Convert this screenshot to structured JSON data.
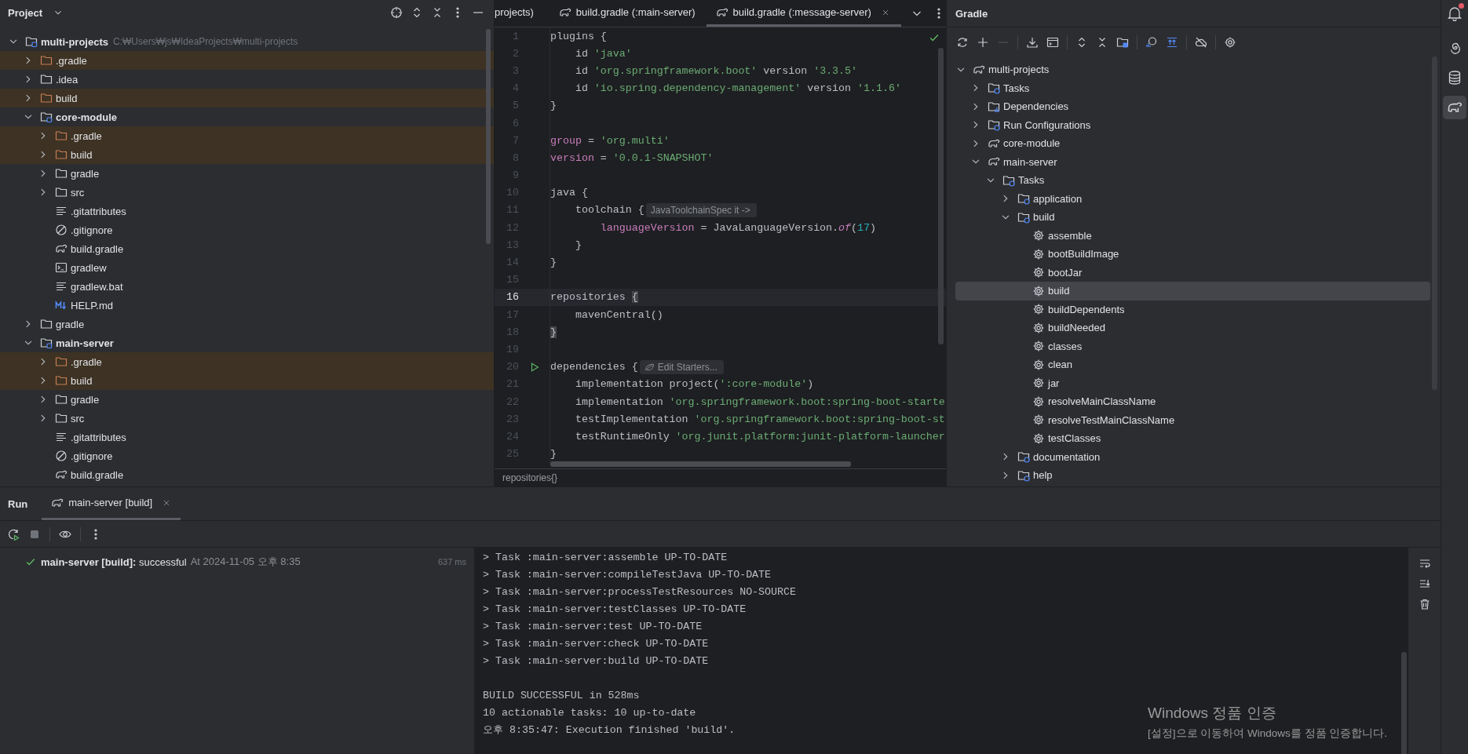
{
  "project": {
    "title": "Project",
    "tree": [
      {
        "name": "multi-projects",
        "kind": "module",
        "path": "C:₩Users₩js₩IdeaProjects₩multi-projects",
        "expanded": true,
        "children": [
          {
            "name": ".gradle",
            "kind": "folder",
            "excluded": true,
            "expanded": false
          },
          {
            "name": ".idea",
            "kind": "folder",
            "excluded": false,
            "expanded": false
          },
          {
            "name": "build",
            "kind": "folder",
            "excluded": true,
            "expanded": false
          },
          {
            "name": "core-module",
            "kind": "module",
            "expanded": true,
            "children": [
              {
                "name": ".gradle",
                "kind": "folder",
                "excluded": true,
                "expanded": false
              },
              {
                "name": "build",
                "kind": "folder",
                "excluded": true,
                "expanded": false
              },
              {
                "name": "gradle",
                "kind": "folder",
                "excluded": false,
                "expanded": false
              },
              {
                "name": "src",
                "kind": "folder",
                "excluded": false,
                "expanded": false
              },
              {
                "name": ".gitattributes",
                "kind": "text"
              },
              {
                "name": ".gitignore",
                "kind": "ignore"
              },
              {
                "name": "build.gradle",
                "kind": "gradle"
              },
              {
                "name": "gradlew",
                "kind": "terminal"
              },
              {
                "name": "gradlew.bat",
                "kind": "text"
              },
              {
                "name": "HELP.md",
                "kind": "markdown"
              }
            ]
          },
          {
            "name": "gradle",
            "kind": "folder",
            "excluded": false,
            "expanded": false
          },
          {
            "name": "main-server",
            "kind": "module",
            "expanded": true,
            "children": [
              {
                "name": ".gradle",
                "kind": "folder",
                "excluded": true,
                "expanded": false
              },
              {
                "name": "build",
                "kind": "folder",
                "excluded": true,
                "expanded": false
              },
              {
                "name": "gradle",
                "kind": "folder",
                "excluded": false,
                "expanded": false
              },
              {
                "name": "src",
                "kind": "folder",
                "excluded": false,
                "expanded": false
              },
              {
                "name": ".gitattributes",
                "kind": "text"
              },
              {
                "name": ".gitignore",
                "kind": "ignore"
              },
              {
                "name": "build.gradle",
                "kind": "gradle"
              }
            ]
          }
        ]
      }
    ]
  },
  "editor": {
    "tabs": [
      {
        "label": "projects)",
        "kind": "cut",
        "selected": false
      },
      {
        "label": "build.gradle (:main-server)",
        "kind": "file",
        "selected": false
      },
      {
        "label": "build.gradle (:message-server)",
        "kind": "file",
        "selected": true
      }
    ],
    "lines": [
      {
        "n": "1",
        "current": false,
        "run": false,
        "code": [
          {
            "text": "plugins {",
            "kind": "plain"
          }
        ]
      },
      {
        "n": "2",
        "current": false,
        "run": false,
        "code": [
          {
            "text": "    id ",
            "kind": "plain"
          },
          {
            "text": "'java'",
            "kind": "string"
          }
        ]
      },
      {
        "n": "3",
        "current": false,
        "run": false,
        "code": [
          {
            "text": "    id ",
            "kind": "plain"
          },
          {
            "text": "'org.springframework.boot'",
            "kind": "string"
          },
          {
            "text": " version ",
            "kind": "plain"
          },
          {
            "text": "'3.3.5'",
            "kind": "string"
          }
        ]
      },
      {
        "n": "4",
        "current": false,
        "run": false,
        "code": [
          {
            "text": "    id ",
            "kind": "plain"
          },
          {
            "text": "'io.spring.dependency-management'",
            "kind": "string"
          },
          {
            "text": " version ",
            "kind": "plain"
          },
          {
            "text": "'1.1.6'",
            "kind": "string"
          }
        ]
      },
      {
        "n": "5",
        "current": false,
        "run": false,
        "code": [
          {
            "text": "}",
            "kind": "plain"
          }
        ]
      },
      {
        "n": "6",
        "current": false,
        "run": false
      },
      {
        "n": "7",
        "current": false,
        "run": false,
        "code": [
          {
            "text": "group",
            "kind": "property"
          },
          {
            "text": " = ",
            "kind": "plain"
          },
          {
            "text": "'org.multi'",
            "kind": "string"
          }
        ]
      },
      {
        "n": "8",
        "current": false,
        "run": false,
        "code": [
          {
            "text": "version",
            "kind": "property"
          },
          {
            "text": " = ",
            "kind": "plain"
          },
          {
            "text": "'0.0.1-SNAPSHOT'",
            "kind": "string"
          }
        ]
      },
      {
        "n": "9",
        "current": false,
        "run": false
      },
      {
        "n": "10",
        "current": false,
        "run": false,
        "code": [
          {
            "text": "java {",
            "kind": "plain"
          }
        ]
      },
      {
        "n": "11",
        "current": false,
        "run": false,
        "code": [
          {
            "text": "    toolchain {",
            "kind": "plain"
          }
        ],
        "hint": {
          "text": "JavaToolchainSpec it ->",
          "kind": "type"
        }
      },
      {
        "n": "12",
        "current": false,
        "run": false,
        "code": [
          {
            "text": "        languageVersion",
            "kind": "property"
          },
          {
            "text": " = JavaLanguageVersion.",
            "kind": "plain"
          },
          {
            "text": "of",
            "kind": "italic"
          },
          {
            "text": "(",
            "kind": "plain"
          },
          {
            "text": "17",
            "kind": "number"
          },
          {
            "text": ")",
            "kind": "plain"
          }
        ]
      },
      {
        "n": "13",
        "current": false,
        "run": false,
        "code": [
          {
            "text": "    }",
            "kind": "plain"
          }
        ]
      },
      {
        "n": "14",
        "current": false,
        "run": false,
        "code": [
          {
            "text": "}",
            "kind": "plain"
          }
        ]
      },
      {
        "n": "15",
        "current": false,
        "run": false
      },
      {
        "n": "16",
        "current": true,
        "run": false,
        "code": [
          {
            "text": "repositories ",
            "kind": "plain"
          },
          {
            "text": "{",
            "kind": "brace"
          }
        ]
      },
      {
        "n": "17",
        "current": false,
        "run": false,
        "code": [
          {
            "text": "    mavenCentral()",
            "kind": "plain"
          }
        ]
      },
      {
        "n": "18",
        "current": false,
        "run": false,
        "code": [
          {
            "text": "}",
            "kind": "brace"
          }
        ]
      },
      {
        "n": "19",
        "current": false,
        "run": false
      },
      {
        "n": "20",
        "current": false,
        "run": true,
        "code": [
          {
            "text": "dependencies {",
            "kind": "plain"
          }
        ],
        "hint": {
          "text": "Edit Starters...",
          "kind": "spring"
        }
      },
      {
        "n": "21",
        "current": false,
        "run": false,
        "code": [
          {
            "text": "    implementation project(",
            "kind": "plain"
          },
          {
            "text": "':core-module'",
            "kind": "string"
          },
          {
            "text": ")",
            "kind": "plain"
          }
        ]
      },
      {
        "n": "22",
        "current": false,
        "run": false,
        "code": [
          {
            "text": "    implementation ",
            "kind": "plain"
          },
          {
            "text": "'org.springframework.boot:spring-boot-starte",
            "kind": "string"
          }
        ]
      },
      {
        "n": "23",
        "current": false,
        "run": false,
        "code": [
          {
            "text": "    testImplementation ",
            "kind": "plain"
          },
          {
            "text": "'org.springframework.boot:spring-boot-st",
            "kind": "string"
          }
        ]
      },
      {
        "n": "24",
        "current": false,
        "run": false,
        "code": [
          {
            "text": "    testRuntimeOnly ",
            "kind": "plain"
          },
          {
            "text": "'org.junit.platform:junit-platform-launcher",
            "kind": "string"
          }
        ]
      },
      {
        "n": "25",
        "current": false,
        "run": false,
        "code": [
          {
            "text": "}",
            "kind": "plain"
          }
        ]
      }
    ],
    "breadcrumb": "repositories{}"
  },
  "gradle": {
    "title": "Gradle",
    "tree": [
      {
        "name": "multi-projects",
        "kind": "gradle",
        "expanded": true,
        "selected": false,
        "children": [
          {
            "name": "Tasks",
            "kind": "tasks",
            "expanded": false,
            "selected": false
          },
          {
            "name": "Dependencies",
            "kind": "deps",
            "expanded": false,
            "selected": false
          },
          {
            "name": "Run Configurations",
            "kind": "tasks",
            "expanded": false,
            "selected": false
          },
          {
            "name": "core-module",
            "kind": "gradle",
            "expanded": false,
            "selected": false
          },
          {
            "name": "main-server",
            "kind": "gradle",
            "expanded": true,
            "selected": false,
            "children": [
              {
                "name": "Tasks",
                "kind": "tasks",
                "expanded": true,
                "selected": false,
                "children": [
                  {
                    "name": "application",
                    "kind": "tasks",
                    "expanded": false,
                    "selected": false
                  },
                  {
                    "name": "build",
                    "kind": "tasks",
                    "expanded": true,
                    "selected": false,
                    "children": [
                      {
                        "name": "assemble",
                        "kind": "task",
                        "selected": false
                      },
                      {
                        "name": "bootBuildImage",
                        "kind": "task",
                        "selected": false
                      },
                      {
                        "name": "bootJar",
                        "kind": "task",
                        "selected": false
                      },
                      {
                        "name": "build",
                        "kind": "task",
                        "selected": true
                      },
                      {
                        "name": "buildDependents",
                        "kind": "task",
                        "selected": false
                      },
                      {
                        "name": "buildNeeded",
                        "kind": "task",
                        "selected": false
                      },
                      {
                        "name": "classes",
                        "kind": "task",
                        "selected": false
                      },
                      {
                        "name": "clean",
                        "kind": "task",
                        "selected": false
                      },
                      {
                        "name": "jar",
                        "kind": "task",
                        "selected": false
                      },
                      {
                        "name": "resolveMainClassName",
                        "kind": "task",
                        "selected": false
                      },
                      {
                        "name": "resolveTestMainClassName",
                        "kind": "task",
                        "selected": false
                      },
                      {
                        "name": "testClasses",
                        "kind": "task",
                        "selected": false
                      }
                    ]
                  },
                  {
                    "name": "documentation",
                    "kind": "tasks",
                    "expanded": false,
                    "selected": false
                  },
                  {
                    "name": "help",
                    "kind": "tasks",
                    "expanded": false,
                    "selected": false
                  }
                ]
              }
            ]
          }
        ]
      }
    ]
  },
  "tool_windows": [
    {
      "kind": "notifications",
      "badge": true,
      "selected": false
    },
    {
      "kind": "spiral",
      "badge": false,
      "selected": false
    },
    {
      "kind": "database",
      "badge": false,
      "selected": false
    },
    {
      "kind": "gradle",
      "badge": false,
      "selected": true
    }
  ],
  "run": {
    "title": "Run",
    "tabs": [
      {
        "label": "main-server [build]",
        "selected": true
      }
    ],
    "result": {
      "label": "**main-server [build]:** successful",
      "time": "At 2024-11-05 오후 8:35",
      "duration": "637 ms",
      "success": true
    },
    "console": {
      "lines": [
        "> Task :main-server:assemble UP-TO-DATE",
        "> Task :main-server:compileTestJava UP-TO-DATE",
        "> Task :main-server:processTestResources NO-SOURCE",
        "> Task :main-server:testClasses UP-TO-DATE",
        "> Task :main-server:test UP-TO-DATE",
        "> Task :main-server:check UP-TO-DATE",
        "> Task :main-server:build UP-TO-DATE"
      ],
      "summary": [
        "BUILD SUCCESSFUL in 528ms",
        "10 actionable tasks: 10 up-to-date",
        "오후 8:35:47: Execution finished 'build'."
      ]
    }
  },
  "os_notice": {
    "title": "Windows 정품 인증",
    "text": "[설정]으로 이동하여 Windows를 정품 인증합니다."
  }
}
